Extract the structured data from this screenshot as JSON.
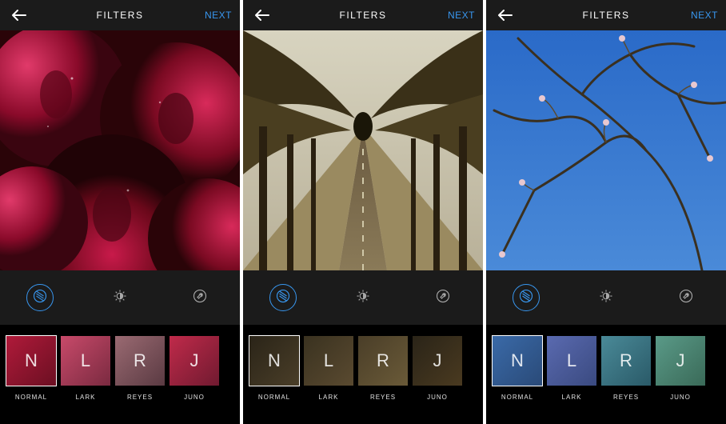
{
  "screens": [
    {
      "header": {
        "title": "FILTERS",
        "next": "NEXT"
      },
      "tools": {
        "filter_active": true
      },
      "image_kind": "roses",
      "filters": [
        {
          "letter": "N",
          "label": "NORMAL",
          "selected": true
        },
        {
          "letter": "L",
          "label": "LARK",
          "selected": false
        },
        {
          "letter": "R",
          "label": "REYES",
          "selected": false
        },
        {
          "letter": "J",
          "label": "JUNO",
          "selected": false
        }
      ],
      "thumb_palette": [
        "#b01a3a,#6b0f22",
        "#c84a6a,#7a2a40",
        "#9a6a72,#5a3a42",
        "#c02a4a,#701a30"
      ]
    },
    {
      "header": {
        "title": "FILTERS",
        "next": "NEXT"
      },
      "tools": {
        "filter_active": true
      },
      "image_kind": "road",
      "filters": [
        {
          "letter": "N",
          "label": "NORMAL",
          "selected": true
        },
        {
          "letter": "L",
          "label": "LARK",
          "selected": false
        },
        {
          "letter": "R",
          "label": "REYES",
          "selected": false
        },
        {
          "letter": "J",
          "label": "JUNO",
          "selected": false
        }
      ],
      "thumb_palette": [
        "#2a2418,#4a3e28",
        "#3a3220,#5a4a30",
        "#4a3e28,#6a5a38",
        "#2a2418,#4a3a20"
      ]
    },
    {
      "header": {
        "title": "FILTERS",
        "next": "NEXT"
      },
      "tools": {
        "filter_active": true
      },
      "image_kind": "branches",
      "filters": [
        {
          "letter": "N",
          "label": "NORMAL",
          "selected": true
        },
        {
          "letter": "L",
          "label": "LARK",
          "selected": false
        },
        {
          "letter": "R",
          "label": "REYES",
          "selected": false
        },
        {
          "letter": "J",
          "label": "JUNO",
          "selected": false
        }
      ],
      "thumb_palette": [
        "#3a6aa8,#2a4a78",
        "#5a6ab0,#3a4a80",
        "#4a8a98,#2a5a68",
        "#5a9a88,#3a6a58"
      ]
    }
  ],
  "icons": {
    "filter": "filter-icon",
    "lux": "lux-icon",
    "wrench": "wrench-icon",
    "back": "back-arrow-icon"
  }
}
